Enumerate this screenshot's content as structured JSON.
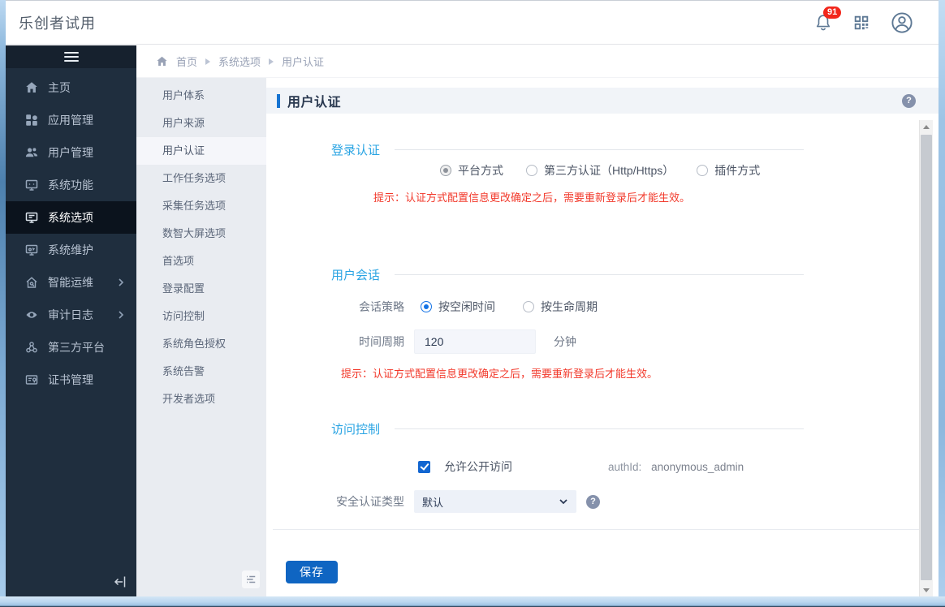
{
  "header": {
    "title": "乐创者试用",
    "notification_count": "91"
  },
  "breadcrumb": {
    "items": [
      "首页",
      "系统选项",
      "用户认证"
    ]
  },
  "sidebar": {
    "items": [
      {
        "label": "主页",
        "icon": "home-icon"
      },
      {
        "label": "应用管理",
        "icon": "apps-icon"
      },
      {
        "label": "用户管理",
        "icon": "users-icon"
      },
      {
        "label": "系统功能",
        "icon": "system-functions-icon"
      },
      {
        "label": "系统选项",
        "icon": "system-options-icon",
        "active": true
      },
      {
        "label": "系统维护",
        "icon": "system-maintenance-icon"
      },
      {
        "label": "智能运维",
        "icon": "smart-ops-icon",
        "expandable": true
      },
      {
        "label": "审计日志",
        "icon": "audit-log-icon",
        "expandable": true
      },
      {
        "label": "第三方平台",
        "icon": "third-party-icon"
      },
      {
        "label": "证书管理",
        "icon": "certificate-icon"
      }
    ]
  },
  "submenu": {
    "active": "用户认证",
    "items": [
      "用户体系",
      "用户来源",
      "用户认证",
      "工作任务选项",
      "采集任务选项",
      "数智大屏选项",
      "首选项",
      "登录配置",
      "访问控制",
      "系统角色授权",
      "系统告警",
      "开发者选项"
    ]
  },
  "page": {
    "title": "用户认证"
  },
  "form": {
    "login_auth": {
      "section_title": "登录认证",
      "options": [
        "平台方式",
        "第三方认证（Http/Https）",
        "插件方式"
      ],
      "selected": "平台方式",
      "hint": "提示：认证方式配置信息更改确定之后，需要重新登录后才能生效。"
    },
    "user_session": {
      "section_title": "用户会话",
      "policy_label": "会话策略",
      "policy_options": [
        "按空闲时间",
        "按生命周期"
      ],
      "policy_selected": "按空闲时间",
      "period_label": "时间周期",
      "period_value": "120",
      "period_unit": "分钟",
      "hint": "提示：认证方式配置信息更改确定之后，需要重新登录后才能生效。"
    },
    "access_control": {
      "section_title": "访问控制",
      "checkbox_label": "允许公开访问",
      "checkbox_checked": true,
      "auth_id_label": "authId:",
      "auth_id_value": "anonymous_admin",
      "security_type_label": "安全认证类型",
      "security_type_value": "默认"
    },
    "save_label": "保存"
  },
  "colors": {
    "accent_blue": "#1774d2",
    "section_blue": "#2aa4e3",
    "hint_red": "#f2392b",
    "sidebar_dark": "#1f2e3e",
    "sidebar_selected": "#0b131d",
    "submenu_bg": "#e9ecf1",
    "save_button": "#0f65c2",
    "badge_red": "#f2271c",
    "radio_blue": "#1473e6",
    "checkbox_blue": "#1266d1"
  }
}
